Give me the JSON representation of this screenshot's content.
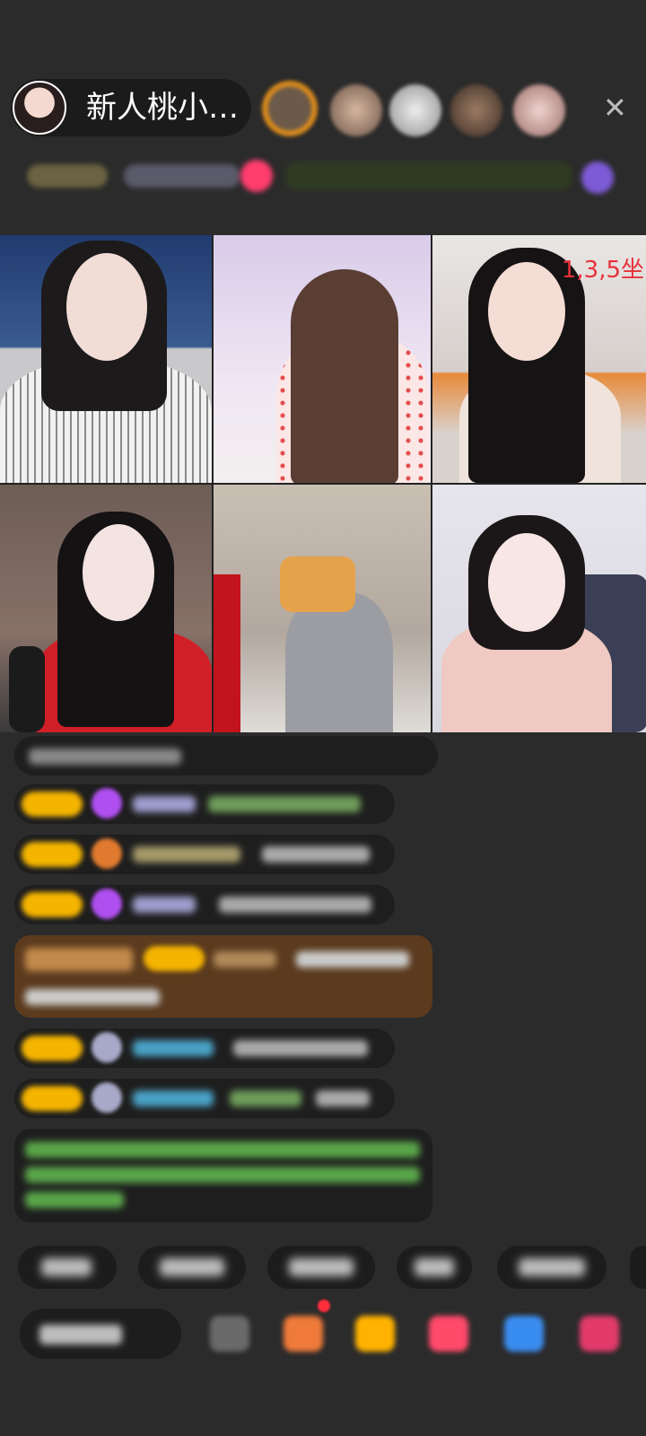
{
  "header": {
    "host_name": "新人桃小…",
    "close_icon": "close-icon"
  },
  "video_grid": {
    "tiles": [
      {
        "label": ""
      },
      {
        "label": ""
      },
      {
        "label": "1,3,5坐"
      },
      {
        "label": ""
      },
      {
        "label": ""
      },
      {
        "label": ""
      }
    ]
  },
  "colors": {
    "background": "#2b2b2b",
    "badge_gold": "#f4b400",
    "accent_pink": "#ff3d6e",
    "label_red": "#e8313b"
  }
}
